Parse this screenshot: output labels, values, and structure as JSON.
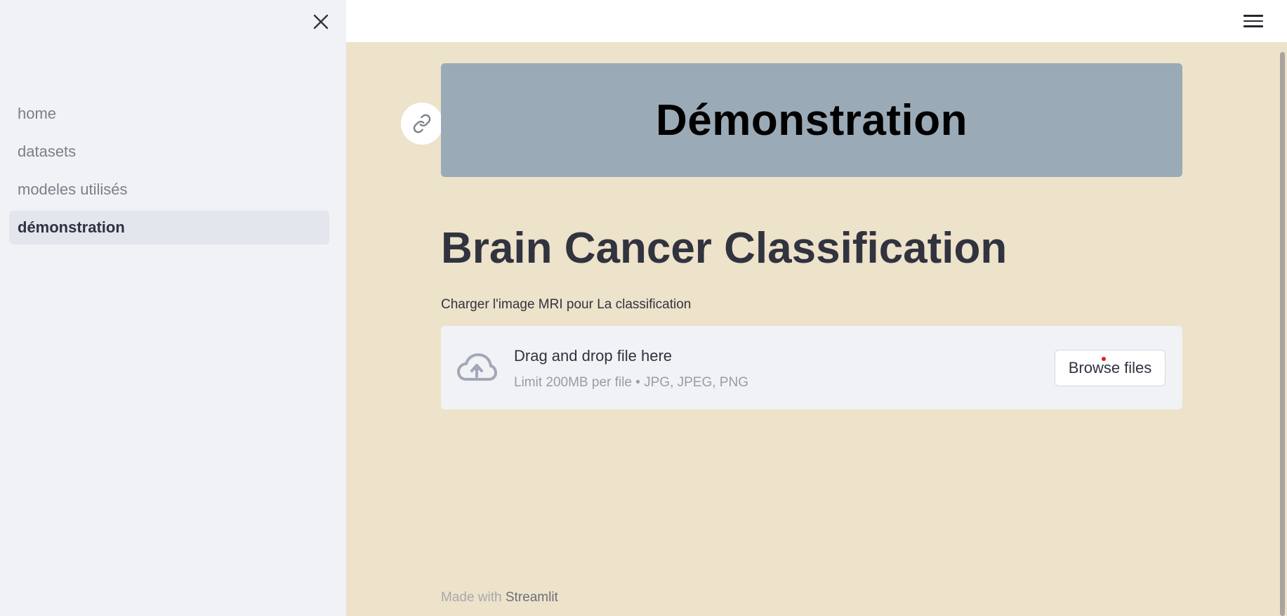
{
  "sidebar": {
    "close_icon": "close-icon",
    "items": [
      {
        "label": "home",
        "active": false
      },
      {
        "label": "datasets",
        "active": false
      },
      {
        "label": "modeles utilisés",
        "active": false
      },
      {
        "label": "démonstration",
        "active": true
      }
    ]
  },
  "header": {
    "menu_icon": "hamburger-menu-icon"
  },
  "main": {
    "banner_title": "Démonstration",
    "anchor_icon": "link-icon",
    "heading": "Brain Cancer Classification",
    "uploader": {
      "label": "Charger l'image MRI pour La classification",
      "drop_title": "Drag and drop file here",
      "drop_subtitle": "Limit 200MB per file • JPG, JPEG, PNG",
      "browse_label": "Browse files",
      "upload_icon": "cloud-upload-icon"
    }
  },
  "footer": {
    "prefix": "Made with ",
    "link": "Streamlit"
  },
  "colors": {
    "page_bg": "#ede2ca",
    "sidebar_bg": "#f0f2f6",
    "banner_bg": "#9baab7",
    "active_item_bg": "#e3e6ec",
    "text_dark": "#31333f"
  }
}
